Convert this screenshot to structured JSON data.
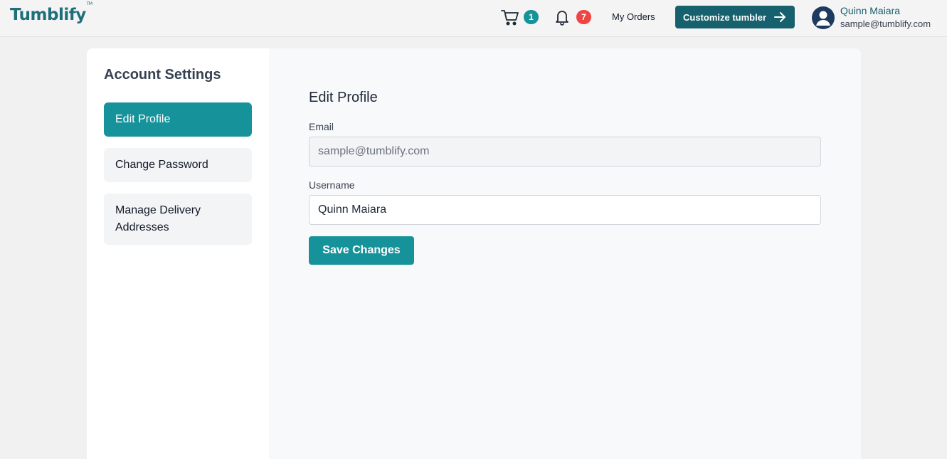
{
  "header": {
    "logo_text": "Tumblify",
    "logo_mark": "TM",
    "cart": {
      "icon": "cart-icon",
      "count": "1",
      "badge_color": "#16939a"
    },
    "notifications": {
      "icon": "bell-icon",
      "count": "7",
      "badge_color": "#ef4444"
    },
    "my_orders_label": "My Orders",
    "customize_label": "Customize tumbler",
    "customize_icon": "arrow-right-icon",
    "user": {
      "name": "Quinn Maiara",
      "email": "sample@tumblify.com",
      "avatar_icon": "user-avatar-icon"
    }
  },
  "sidebar": {
    "title": "Account Settings",
    "items": [
      {
        "label": "Edit Profile",
        "active": true
      },
      {
        "label": "Change Password",
        "active": false
      },
      {
        "label": "Manage Delivery Addresses",
        "active": false
      }
    ]
  },
  "main": {
    "section_title": "Edit Profile",
    "email": {
      "label": "Email",
      "value": "sample@tumblify.com",
      "disabled": true
    },
    "username": {
      "label": "Username",
      "value": "Quinn Maiara"
    },
    "save_label": "Save Changes"
  },
  "colors": {
    "brand": "#17606d",
    "accent": "#16939a",
    "alert": "#ef4444"
  }
}
